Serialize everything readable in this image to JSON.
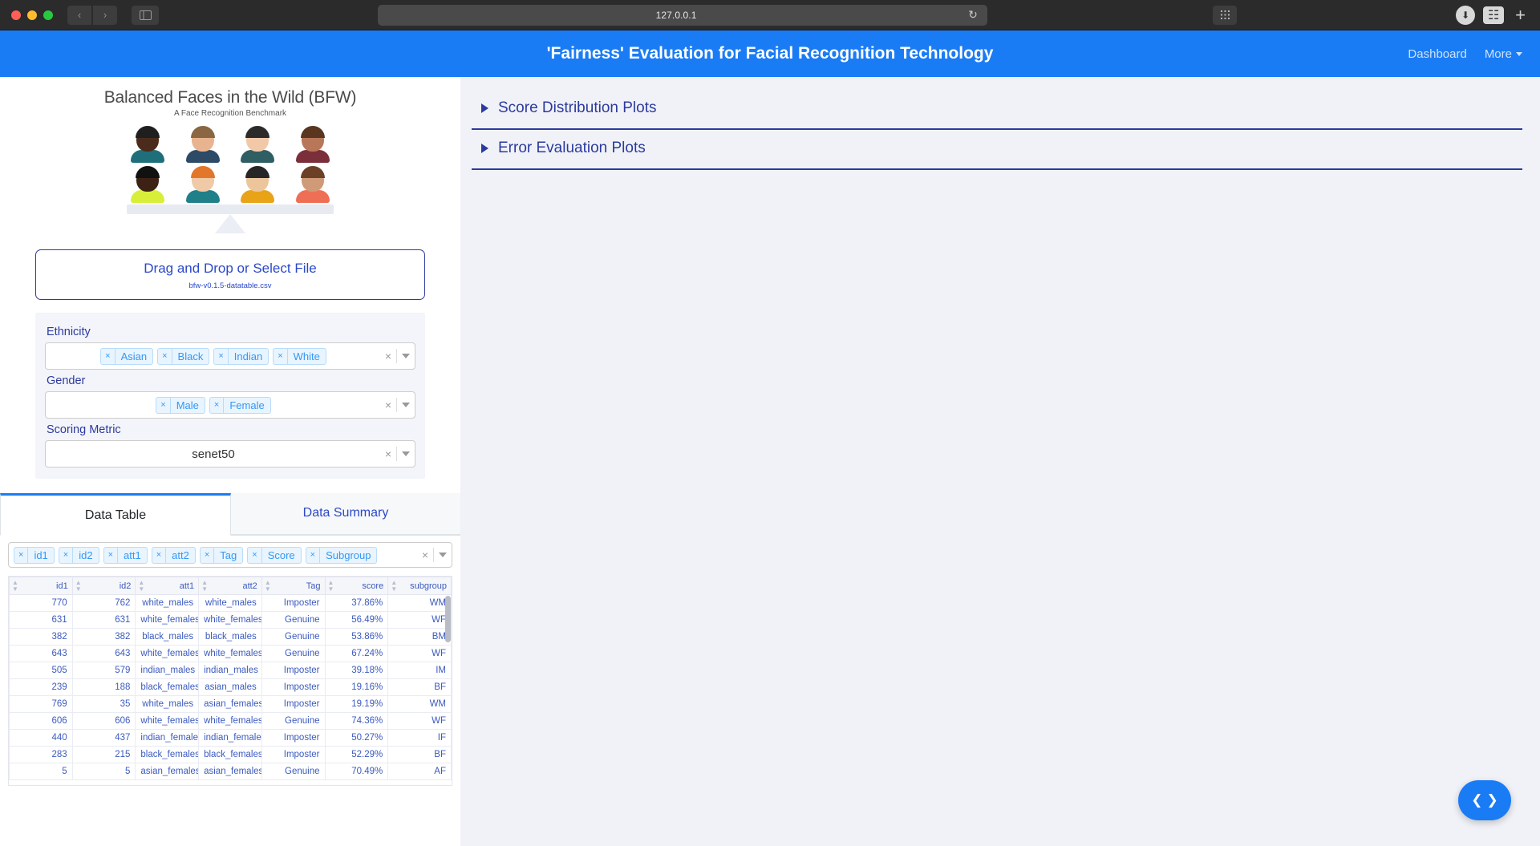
{
  "browser": {
    "url": "127.0.0.1",
    "back_icon": "chevron-left-icon",
    "forward_icon": "chevron-right-icon",
    "sidebar_icon": "sidebar-toggle-icon",
    "reload_icon": "reload-icon",
    "extensions_icon": "grid-icon",
    "download_icon": "download-icon",
    "tabs_icon": "tab-overview-icon",
    "new_tab_icon": "plus-icon"
  },
  "header": {
    "title": "'Fairness' Evaluation for Facial Recognition Technology",
    "nav": [
      {
        "label": "Dashboard"
      },
      {
        "label": "More"
      }
    ],
    "accent_color": "#1a7cf5"
  },
  "logo": {
    "title": "Balanced Faces in the Wild (BFW)",
    "subtitle": "A Face Recognition Benchmark",
    "faces": [
      {
        "hair": "#1f1f1f",
        "skin": "#4b2c1c",
        "shirt": "#1f6f7a"
      },
      {
        "hair": "#8a6642",
        "skin": "#e8b48f",
        "shirt": "#2d4a66"
      },
      {
        "hair": "#2b2b2b",
        "skin": "#f2c9a8",
        "shirt": "#2f5e63"
      },
      {
        "hair": "#5a3520",
        "skin": "#b9775a",
        "shirt": "#7b2f3a"
      },
      {
        "hair": "#111111",
        "skin": "#3d2114",
        "shirt": "#d8ef3a"
      },
      {
        "hair": "#e2762a",
        "skin": "#f0c9a6",
        "shirt": "#20808a"
      },
      {
        "hair": "#262626",
        "skin": "#edc59c",
        "shirt": "#e8a317"
      },
      {
        "hair": "#6b4026",
        "skin": "#cf9a77",
        "shirt": "#ef6f56"
      }
    ]
  },
  "upload": {
    "main_label": "Drag and Drop or Select File",
    "file_name": "bfw-v0.1.5-datatable.csv"
  },
  "filters": [
    {
      "label": "Ethnicity",
      "name": "ethnicity",
      "multi": true,
      "values": [
        "Asian",
        "Black",
        "Indian",
        "White"
      ]
    },
    {
      "label": "Gender",
      "name": "gender",
      "multi": true,
      "values": [
        "Male",
        "Female"
      ]
    },
    {
      "label": "Scoring Metric",
      "name": "scoring-metric",
      "multi": false,
      "value": "senet50"
    }
  ],
  "tabs": [
    {
      "label": "Data Table",
      "active": true
    },
    {
      "label": "Data Summary",
      "active": false
    }
  ],
  "column_chips": [
    "id1",
    "id2",
    "att1",
    "att2",
    "Tag",
    "Score",
    "Subgroup"
  ],
  "table": {
    "columns": [
      "id1",
      "id2",
      "att1",
      "att2",
      "Tag",
      "score",
      "subgroup"
    ],
    "rows": [
      [
        "770",
        "762",
        "white_males",
        "white_males",
        "Imposter",
        "37.86%",
        "WM"
      ],
      [
        "631",
        "631",
        "white_females",
        "white_females",
        "Genuine",
        "56.49%",
        "WF"
      ],
      [
        "382",
        "382",
        "black_males",
        "black_males",
        "Genuine",
        "53.86%",
        "BM"
      ],
      [
        "643",
        "643",
        "white_females",
        "white_females",
        "Genuine",
        "67.24%",
        "WF"
      ],
      [
        "505",
        "579",
        "indian_males",
        "indian_males",
        "Imposter",
        "39.18%",
        "IM"
      ],
      [
        "239",
        "188",
        "black_females",
        "asian_males",
        "Imposter",
        "19.16%",
        "BF"
      ],
      [
        "769",
        "35",
        "white_males",
        "asian_females",
        "Imposter",
        "19.19%",
        "WM"
      ],
      [
        "606",
        "606",
        "white_females",
        "white_females",
        "Genuine",
        "74.36%",
        "WF"
      ],
      [
        "440",
        "437",
        "indian_females",
        "indian_females",
        "Imposter",
        "50.27%",
        "IF"
      ],
      [
        "283",
        "215",
        "black_females",
        "black_females",
        "Imposter",
        "52.29%",
        "BF"
      ],
      [
        "5",
        "5",
        "asian_females",
        "asian_females",
        "Genuine",
        "70.49%",
        "AF"
      ]
    ]
  },
  "accordions": [
    {
      "label": "Score Distribution Plots",
      "expanded": false
    },
    {
      "label": "Error Evaluation Plots",
      "expanded": false
    }
  ],
  "fab": {
    "prev_icon": "chevron-left-icon",
    "next_icon": "chevron-right-icon"
  }
}
